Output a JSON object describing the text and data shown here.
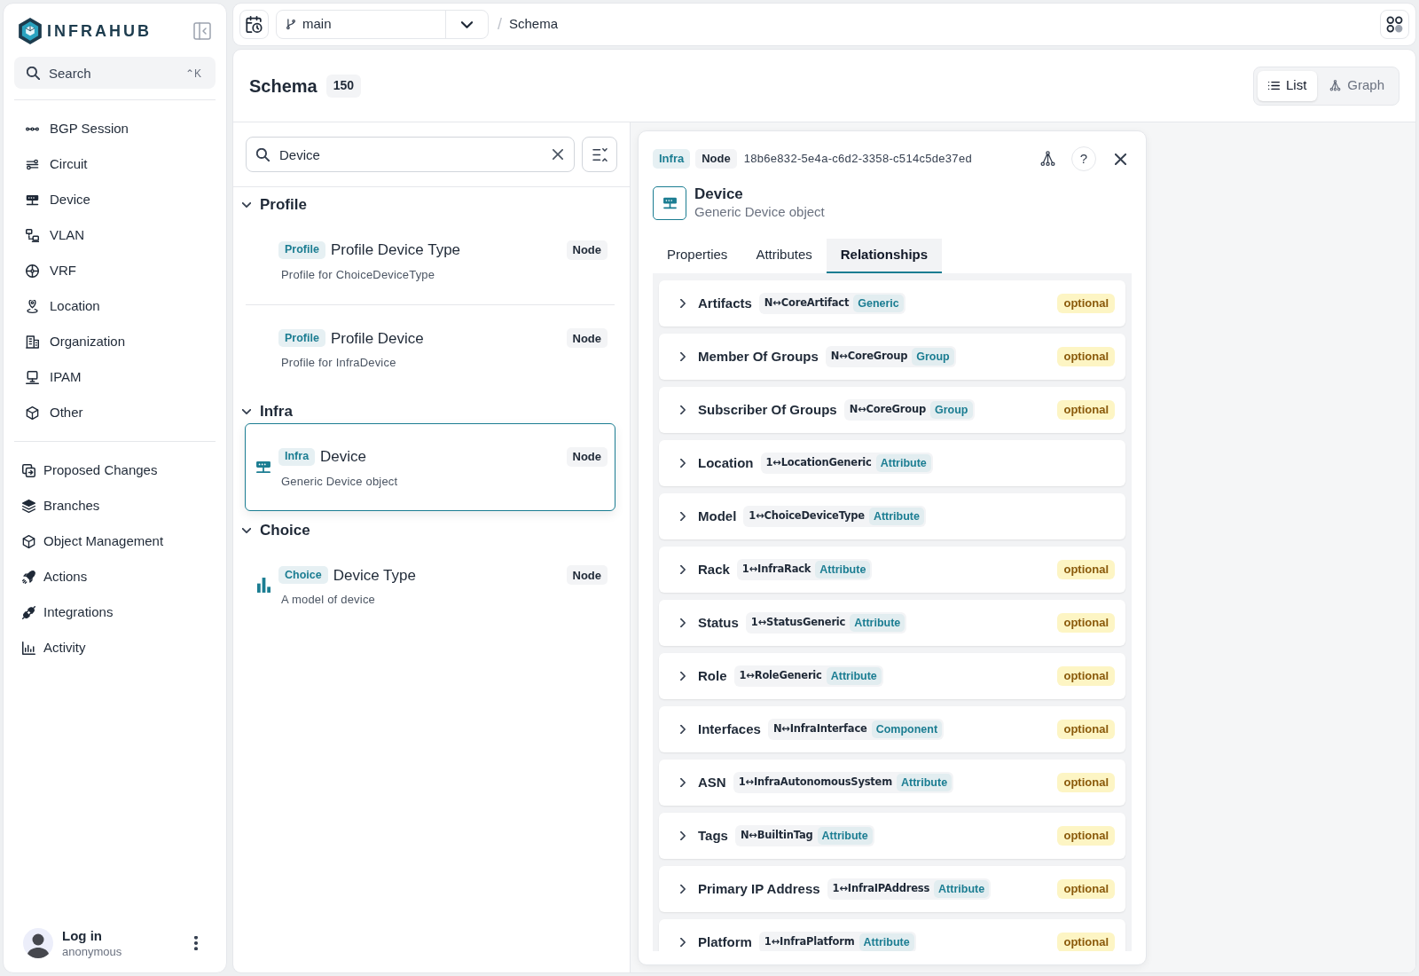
{
  "sidebar": {
    "brand": "INFRAHUB",
    "search": {
      "placeholder": "Search",
      "shortcut": "⌃K"
    },
    "sections": [
      {
        "items": [
          "BGP Session",
          "Circuit",
          "Device",
          "VLAN",
          "VRF",
          "Location",
          "Organization",
          "IPAM",
          "Other"
        ]
      },
      {
        "items": [
          "Proposed Changes",
          "Branches",
          "Object Management",
          "Actions",
          "Integrations",
          "Activity"
        ]
      }
    ],
    "user": {
      "name": "Log in",
      "role": "anonymous"
    }
  },
  "top_bar": {
    "branch": "main",
    "breadcrumb_separator": "/",
    "breadcrumb": "Schema"
  },
  "header": {
    "title": "Schema",
    "count": "150",
    "views": [
      {
        "label": "List",
        "selected": true
      },
      {
        "label": "Graph",
        "selected": false
      }
    ]
  },
  "schema_list": {
    "search": {
      "value": "Device"
    },
    "groups": [
      {
        "label": "Profile",
        "expanded": true,
        "items": [
          {
            "kind": "bare",
            "namespace": "Profile",
            "label": "Profile Device Type",
            "type": "Node",
            "description": "Profile for ChoiceDeviceType",
            "selected": false
          },
          {
            "kind": "bare",
            "namespace": "Profile",
            "label": "Profile Device",
            "type": "Node",
            "description": "Profile for InfraDevice",
            "selected": false
          }
        ]
      },
      {
        "label": "Infra",
        "expanded": true,
        "items": [
          {
            "kind": "device",
            "namespace": "Infra",
            "label": "Device",
            "type": "Node",
            "description": "Generic Device object",
            "selected": true
          }
        ]
      },
      {
        "label": "Choice",
        "expanded": true,
        "items": [
          {
            "kind": "choice",
            "namespace": "Choice",
            "label": "Device Type",
            "type": "Node",
            "description": "A model of device",
            "selected": false
          }
        ]
      }
    ]
  },
  "detail": {
    "namespace": "Infra",
    "type": "Node",
    "id": "18b6e832-5e4a-c6d2-3358-c514c5de37ed",
    "help": "?",
    "title": "Device",
    "description": "Generic Device object",
    "tabs": [
      {
        "label": "Properties",
        "selected": false
      },
      {
        "label": "Attributes",
        "selected": false
      },
      {
        "label": "Relationships",
        "selected": true
      }
    ],
    "relationships": [
      {
        "name": "Artifacts",
        "peer": "N↔CoreArtifact",
        "category": "Generic",
        "requirement": "optional",
        "expanded": false
      },
      {
        "name": "Member Of Groups",
        "peer": "N↔CoreGroup",
        "category": "Group",
        "requirement": "optional",
        "expanded": false
      },
      {
        "name": "Subscriber Of Groups",
        "peer": "N↔CoreGroup",
        "category": "Group",
        "requirement": "optional",
        "expanded": false
      },
      {
        "name": "Location",
        "peer": "1↔LocationGeneric",
        "category": "Attribute",
        "expanded": false
      },
      {
        "name": "Model",
        "peer": "1↔ChoiceDeviceType",
        "category": "Attribute",
        "expanded": false
      },
      {
        "name": "Rack",
        "peer": "1↔InfraRack",
        "category": "Attribute",
        "requirement": "optional",
        "expanded": false
      },
      {
        "name": "Status",
        "peer": "1↔StatusGeneric",
        "category": "Attribute",
        "requirement": "optional",
        "expanded": false
      },
      {
        "name": "Role",
        "peer": "1↔RoleGeneric",
        "category": "Attribute",
        "requirement": "optional",
        "expanded": false
      },
      {
        "name": "Interfaces",
        "peer": "N↔InfraInterface",
        "category": "Component",
        "requirement": "optional",
        "expanded": false
      },
      {
        "name": "ASN",
        "peer": "1↔InfraAutonomousSystem",
        "category": "Attribute",
        "requirement": "optional",
        "expanded": false
      },
      {
        "name": "Tags",
        "peer": "N↔BuiltinTag",
        "category": "Attribute",
        "requirement": "optional",
        "expanded": false
      },
      {
        "name": "Primary IP Address",
        "peer": "1↔InfraIPAddress",
        "category": "Attribute",
        "requirement": "optional",
        "expanded": false
      },
      {
        "name": "Platform",
        "peer": "1↔InfraPlatform",
        "category": "Attribute",
        "requirement": "optional",
        "expanded": false
      }
    ]
  }
}
